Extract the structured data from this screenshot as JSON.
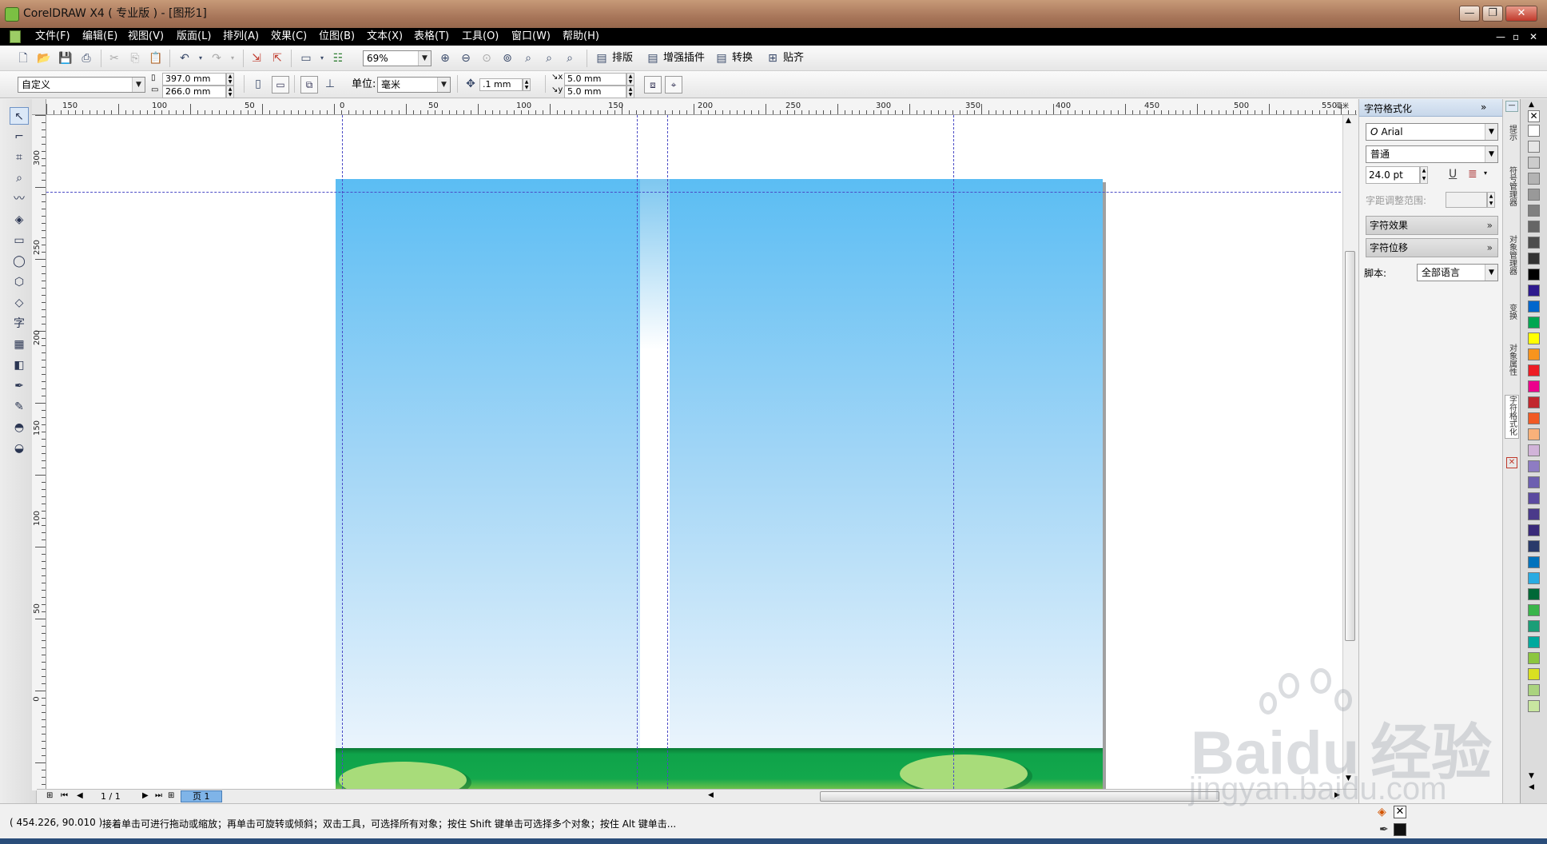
{
  "window": {
    "title": "CorelDRAW X4 ( 专业版 ) - [图形1]",
    "minimize": "—",
    "maximize": "❐",
    "close": "✕",
    "doc_minimize": "—",
    "doc_restore": "▫",
    "doc_close": "✕"
  },
  "menu": [
    "文件(F)",
    "编辑(E)",
    "视图(V)",
    "版面(L)",
    "排列(A)",
    "效果(C)",
    "位图(B)",
    "文本(X)",
    "表格(T)",
    "工具(O)",
    "窗口(W)",
    "帮助(H)"
  ],
  "toolbar": {
    "zoom": "69%",
    "plugins": [
      "排版",
      "增强插件",
      "转换",
      "贴齐"
    ]
  },
  "propertybar": {
    "page_preset": "自定义",
    "width": "397.0 mm",
    "height": "266.0 mm",
    "unit_label": "单位:",
    "unit": "毫米",
    "nudge": ".1 mm",
    "dup_x": "5.0 mm",
    "dup_y": "5.0 mm"
  },
  "rulers": {
    "top_labels": [
      "150",
      "100",
      "50",
      "0",
      "50",
      "100",
      "150",
      "200",
      "250",
      "300",
      "350",
      "400",
      "450",
      "500",
      "550"
    ],
    "top_unit": "毫米",
    "left_labels": [
      "300",
      "250",
      "200",
      "150",
      "100",
      "50",
      "0"
    ],
    "corner_unit": "毫米"
  },
  "page_nav": {
    "counter": "1 / 1",
    "page_tab": "页 1"
  },
  "docker": {
    "title": "字符格式化",
    "font": "Arial",
    "style": "普通",
    "size": "24.0 pt",
    "kerning_label": "字距调整范围:",
    "section_effects": "字符效果",
    "section_shift": "字符位移",
    "script_label": "脚本:",
    "script_value": "全部语言"
  },
  "docker_tabs": [
    "提示",
    "符号管理器",
    "对象管理器",
    "变换",
    "对象属性",
    "字符格式化"
  ],
  "palette": [
    "#ffffff",
    "#e6e6e6",
    "#cccccc",
    "#b3b3b3",
    "#999999",
    "#808080",
    "#666666",
    "#4d4d4d",
    "#333333",
    "#000000",
    "#2e1a8e",
    "#0066cc",
    "#00a651",
    "#ffff00",
    "#f7941d",
    "#ed1c24",
    "#ec008c",
    "#c1272d",
    "#f15a24",
    "#f9b17a",
    "#d1b3d9",
    "#8e7cc3",
    "#6d5fb0",
    "#5b4aa0",
    "#4a3a8a",
    "#3a2a7a",
    "#2a3a6a",
    "#0072bc",
    "#29abe2",
    "#006837",
    "#39b54a",
    "#1b9e77",
    "#00a99d",
    "#8cc63f",
    "#d9e021",
    "#aad37f",
    "#c8e6a0"
  ],
  "status": {
    "coords": "( 454.226, 90.010 )",
    "hint": "接着单击可进行拖动或缩放；再单击可旋转或倾斜；双击工具，可选择所有对象；按住 Shift 键单击可选择多个对象；按住 Alt 键单击..."
  },
  "watermark": {
    "line1": "Bai",
    "paw_text": "du",
    "cn": "经验",
    "line2": "jingyan.baidu.com"
  },
  "colors": {
    "sky_top": "#5bbdf3",
    "sky_bottom": "#eaf4fc",
    "grass": "#0fa34a",
    "grass_dark": "#0b7a36",
    "oval": "#a8dc7a",
    "guide": "#4b4bc6"
  }
}
